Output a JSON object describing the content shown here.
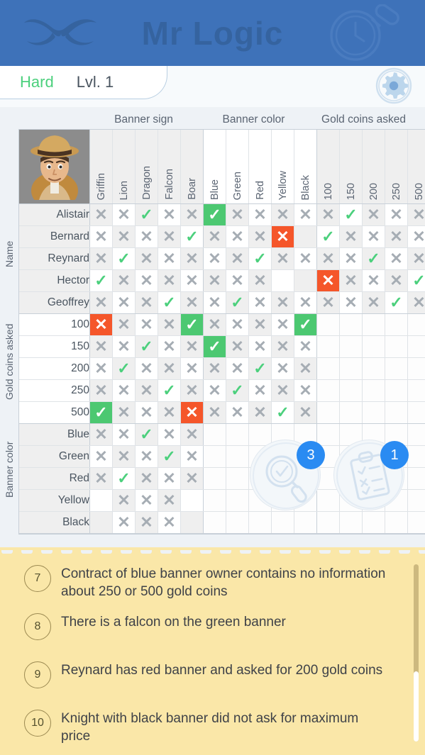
{
  "header": {
    "title": "Mr Logic",
    "moustache_icon": "moustache-icon",
    "magnifier_icon": "magnifier-icon"
  },
  "levelbar": {
    "difficulty": "Hard",
    "level": "Lvl. 1",
    "gear_icon": "gear-icon"
  },
  "colors": {
    "header_bg": "#3e72b9",
    "accent_green": "#4cd07d",
    "accent_red": "#f5562a",
    "badge_blue": "#2a8bf2",
    "clue_bg": "#fae7a8"
  },
  "grid": {
    "top_categories": [
      "Banner sign",
      "Banner color",
      "Gold coins asked"
    ],
    "side_categories": [
      "Name",
      "Gold coins asked",
      "Banner color"
    ],
    "columns": [
      {
        "label": "Griffin",
        "group": 0
      },
      {
        "label": "Lion",
        "group": 0
      },
      {
        "label": "Dragon",
        "group": 0
      },
      {
        "label": "Falcon",
        "group": 0
      },
      {
        "label": "Boar",
        "group": 0
      },
      {
        "label": "Blue",
        "group": 1
      },
      {
        "label": "Green",
        "group": 1
      },
      {
        "label": "Red",
        "group": 1
      },
      {
        "label": "Yellow",
        "group": 1
      },
      {
        "label": "Black",
        "group": 1
      },
      {
        "label": "100",
        "group": 2
      },
      {
        "label": "150",
        "group": 2
      },
      {
        "label": "200",
        "group": 2
      },
      {
        "label": "250",
        "group": 2
      },
      {
        "label": "500",
        "group": 2
      }
    ],
    "rows": [
      {
        "label": "Alistair",
        "group": 0,
        "cells": [
          "x",
          "x",
          "v",
          "x",
          "x",
          "vhi",
          "x",
          "x",
          "x",
          "x",
          "x",
          "v",
          "x",
          "x",
          "x"
        ]
      },
      {
        "label": "Bernard",
        "group": 0,
        "cells": [
          "x",
          "x",
          "x",
          "x",
          "v",
          "x",
          "x",
          "x",
          "xhi",
          "blank",
          "v",
          "x",
          "x",
          "x",
          "x"
        ]
      },
      {
        "label": "Reynard",
        "group": 0,
        "cells": [
          "x",
          "v",
          "x",
          "x",
          "x",
          "x",
          "x",
          "v",
          "x",
          "x",
          "x",
          "x",
          "v",
          "x",
          "x"
        ]
      },
      {
        "label": "Hector",
        "group": 0,
        "cells": [
          "v",
          "x",
          "x",
          "x",
          "x",
          "x",
          "x",
          "x",
          "blank",
          "blank",
          "xhi",
          "x",
          "x",
          "x",
          "v"
        ]
      },
      {
        "label": "Geoffrey",
        "group": 0,
        "cells": [
          "x",
          "x",
          "x",
          "v",
          "x",
          "x",
          "v",
          "x",
          "x",
          "x",
          "x",
          "x",
          "x",
          "v",
          "x"
        ]
      },
      {
        "label": "100",
        "group": 1,
        "cells": [
          "xhi",
          "x",
          "x",
          "x",
          "vhi",
          "x",
          "x",
          "x",
          "x",
          "vhi",
          "void",
          "void",
          "void",
          "void",
          "void"
        ]
      },
      {
        "label": "150",
        "group": 1,
        "cells": [
          "x",
          "x",
          "v",
          "x",
          "x",
          "vhi",
          "x",
          "x",
          "x",
          "x",
          "void",
          "void",
          "void",
          "void",
          "void"
        ]
      },
      {
        "label": "200",
        "group": 1,
        "cells": [
          "x",
          "v",
          "x",
          "x",
          "x",
          "x",
          "x",
          "v",
          "x",
          "x",
          "void",
          "void",
          "void",
          "void",
          "void"
        ]
      },
      {
        "label": "250",
        "group": 1,
        "cells": [
          "x",
          "x",
          "x",
          "v",
          "x",
          "x",
          "v",
          "x",
          "x",
          "x",
          "void",
          "void",
          "void",
          "void",
          "void"
        ]
      },
      {
        "label": "500",
        "group": 1,
        "cells": [
          "vhi",
          "x",
          "x",
          "x",
          "xhi",
          "x",
          "x",
          "x",
          "v",
          "x",
          "void",
          "void",
          "void",
          "void",
          "void"
        ]
      },
      {
        "label": "Blue",
        "group": 2,
        "cells": [
          "x",
          "x",
          "v",
          "x",
          "x",
          "void",
          "void",
          "void",
          "void",
          "void",
          "void",
          "void",
          "void",
          "void",
          "void"
        ]
      },
      {
        "label": "Green",
        "group": 2,
        "cells": [
          "x",
          "x",
          "x",
          "v",
          "x",
          "void",
          "void",
          "void",
          "void",
          "void",
          "void",
          "void",
          "void",
          "void",
          "void"
        ]
      },
      {
        "label": "Red",
        "group": 2,
        "cells": [
          "x",
          "v",
          "x",
          "x",
          "x",
          "void",
          "void",
          "void",
          "void",
          "void",
          "void",
          "void",
          "void",
          "void",
          "void"
        ]
      },
      {
        "label": "Yellow",
        "group": 2,
        "cells": [
          "blank",
          "x",
          "x",
          "x",
          "blank",
          "void",
          "void",
          "void",
          "void",
          "void",
          "void",
          "void",
          "void",
          "void",
          "void"
        ]
      },
      {
        "label": "Black",
        "group": 2,
        "cells": [
          "blank",
          "x",
          "x",
          "x",
          "blank",
          "void",
          "void",
          "void",
          "void",
          "void",
          "void",
          "void",
          "void",
          "void",
          "void"
        ]
      }
    ],
    "avatar_icon": "detective-avatar"
  },
  "actions": [
    {
      "icon": "hint-magnifier-icon",
      "badge": "3"
    },
    {
      "icon": "check-clipboard-icon",
      "badge": "1"
    }
  ],
  "clues": [
    {
      "num": "7",
      "text": "Contract of blue banner owner contains no information about 250 or 500 gold coins"
    },
    {
      "num": "8",
      "text": "There is a falcon on the green banner"
    },
    {
      "num": "9",
      "text": "Reynard has red banner and asked for 200 gold coins"
    },
    {
      "num": "10",
      "text": "Knight with black banner did not ask for maximum price"
    }
  ]
}
